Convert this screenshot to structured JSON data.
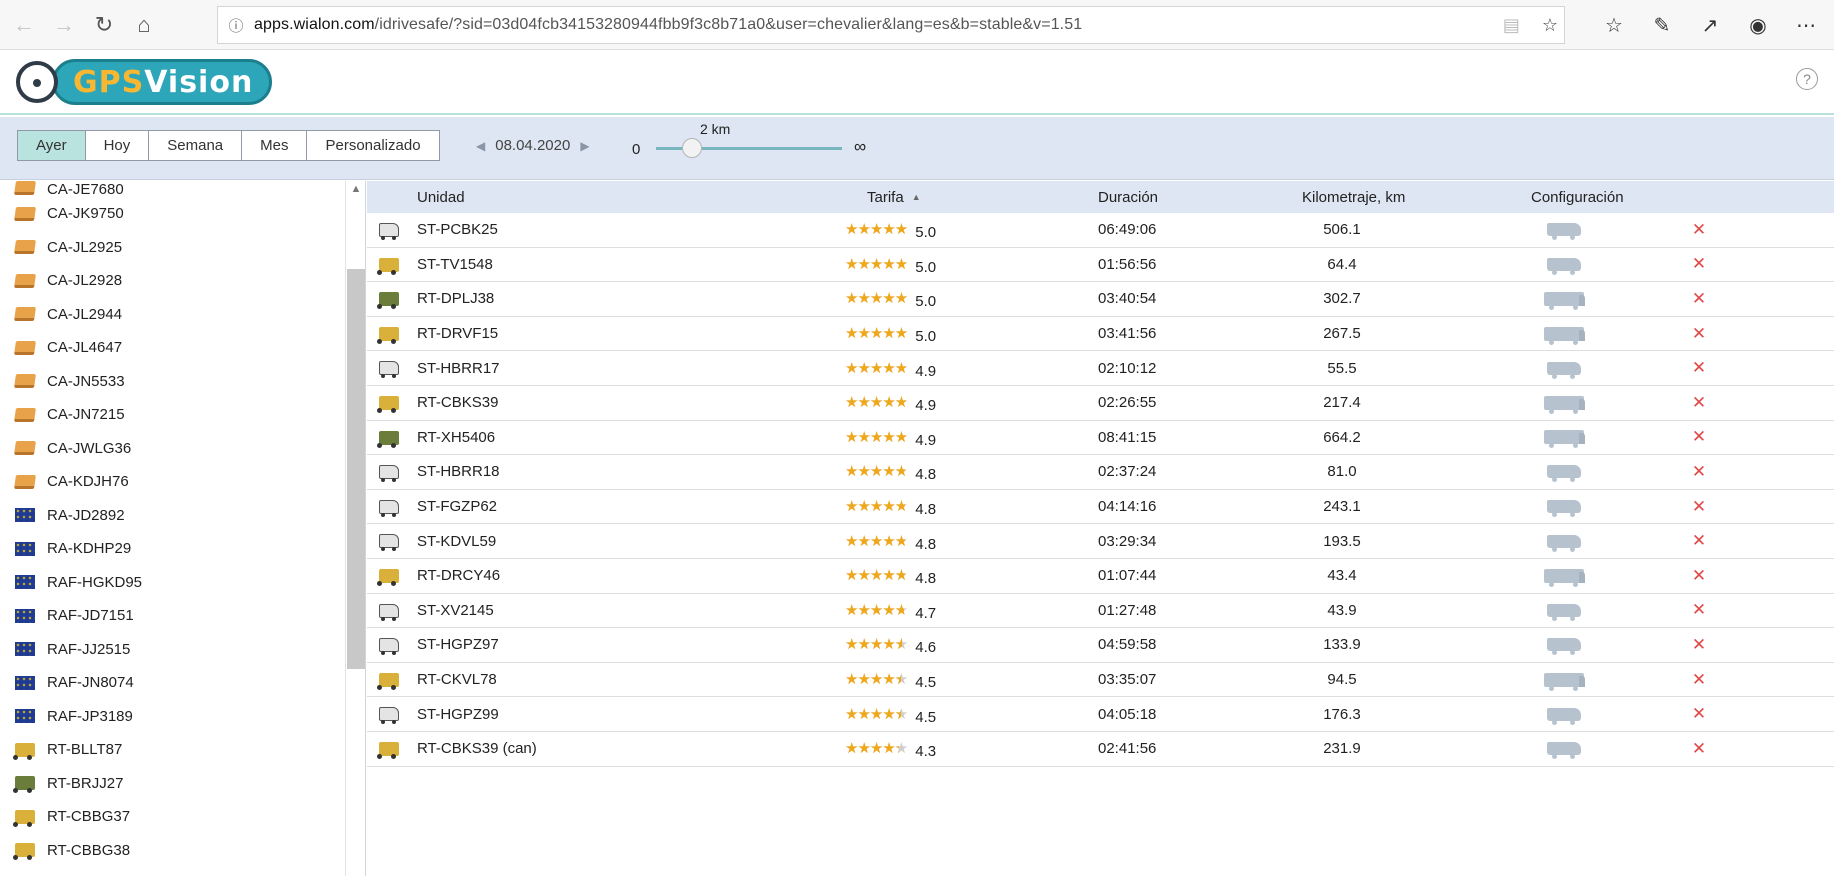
{
  "browser": {
    "url_prefix": "apps.wialon.com",
    "url_path": "/idrivesafe/?sid=03d04fcb34153280944fbb9f3c8b71a0&user=chevalier&lang=es&b=stable&v=1.51"
  },
  "app": {
    "logo_gps": "GPS",
    "logo_vision": "Vision",
    "help": "?"
  },
  "toolbar": {
    "periods": [
      "Ayer",
      "Hoy",
      "Semana",
      "Mes",
      "Personalizado"
    ],
    "active_period": "Ayer",
    "date": "08.04.2020",
    "slider_min": "0",
    "slider_value_label": "2 km",
    "slider_max": "∞"
  },
  "sidebar": {
    "items": [
      {
        "name": "CA-JE7680",
        "icon": "box-icon"
      },
      {
        "name": "CA-JK9750",
        "icon": "box-icon"
      },
      {
        "name": "CA-JL2925",
        "icon": "box-icon"
      },
      {
        "name": "CA-JL2928",
        "icon": "box-icon"
      },
      {
        "name": "CA-JL2944",
        "icon": "box-icon"
      },
      {
        "name": "CA-JL4647",
        "icon": "box-icon"
      },
      {
        "name": "CA-JN5533",
        "icon": "box-icon"
      },
      {
        "name": "CA-JN7215",
        "icon": "box-icon"
      },
      {
        "name": "CA-JWLG36",
        "icon": "box-icon"
      },
      {
        "name": "CA-KDJH76",
        "icon": "box-icon"
      },
      {
        "name": "RA-JD2892",
        "icon": "flag-icon"
      },
      {
        "name": "RA-KDHP29",
        "icon": "flag-icon"
      },
      {
        "name": "RAF-HGKD95",
        "icon": "flag-icon"
      },
      {
        "name": "RAF-JD7151",
        "icon": "flag-icon"
      },
      {
        "name": "RAF-JJ2515",
        "icon": "flag-icon"
      },
      {
        "name": "RAF-JN8074",
        "icon": "flag-icon"
      },
      {
        "name": "RAF-JP3189",
        "icon": "flag-icon"
      },
      {
        "name": "RT-BLLT87",
        "icon": "truck-icon"
      },
      {
        "name": "RT-BRJJ27",
        "icon": "green-truck-icon"
      },
      {
        "name": "RT-CBBG37",
        "icon": "truck-icon"
      },
      {
        "name": "RT-CBBG38",
        "icon": "truck-icon"
      }
    ]
  },
  "table": {
    "headers": {
      "unit": "Unidad",
      "tarifa": "Tarifa",
      "duration": "Duración",
      "km": "Kilometraje, km",
      "config": "Configuración"
    },
    "rows": [
      {
        "unit": "ST-PCBK25",
        "icon": "van-icon",
        "rating": 5.0,
        "score": "5.0",
        "duration": "06:49:06",
        "km": "506.1",
        "config": "van"
      },
      {
        "unit": "ST-TV1548",
        "icon": "truck-icon",
        "rating": 5.0,
        "score": "5.0",
        "duration": "01:56:56",
        "km": "64.4",
        "config": "van"
      },
      {
        "unit": "RT-DPLJ38",
        "icon": "green-truck-icon",
        "rating": 5.0,
        "score": "5.0",
        "duration": "03:40:54",
        "km": "302.7",
        "config": "truck"
      },
      {
        "unit": "RT-DRVF15",
        "icon": "truck-icon",
        "rating": 5.0,
        "score": "5.0",
        "duration": "03:41:56",
        "km": "267.5",
        "config": "truck"
      },
      {
        "unit": "ST-HBRR17",
        "icon": "van-icon",
        "rating": 4.9,
        "score": "4.9",
        "duration": "02:10:12",
        "km": "55.5",
        "config": "van"
      },
      {
        "unit": "RT-CBKS39",
        "icon": "truck-icon",
        "rating": 4.9,
        "score": "4.9",
        "duration": "02:26:55",
        "km": "217.4",
        "config": "truck"
      },
      {
        "unit": "RT-XH5406",
        "icon": "green-truck-icon",
        "rating": 4.9,
        "score": "4.9",
        "duration": "08:41:15",
        "km": "664.2",
        "config": "truck"
      },
      {
        "unit": "ST-HBRR18",
        "icon": "van-icon",
        "rating": 4.8,
        "score": "4.8",
        "duration": "02:37:24",
        "km": "81.0",
        "config": "van"
      },
      {
        "unit": "ST-FGZP62",
        "icon": "van-icon",
        "rating": 4.8,
        "score": "4.8",
        "duration": "04:14:16",
        "km": "243.1",
        "config": "van"
      },
      {
        "unit": "ST-KDVL59",
        "icon": "van-icon",
        "rating": 4.8,
        "score": "4.8",
        "duration": "03:29:34",
        "km": "193.5",
        "config": "van"
      },
      {
        "unit": "RT-DRCY46",
        "icon": "truck-icon",
        "rating": 4.8,
        "score": "4.8",
        "duration": "01:07:44",
        "km": "43.4",
        "config": "truck"
      },
      {
        "unit": "ST-XV2145",
        "icon": "van-icon",
        "rating": 4.7,
        "score": "4.7",
        "duration": "01:27:48",
        "km": "43.9",
        "config": "van"
      },
      {
        "unit": "ST-HGPZ97",
        "icon": "van-icon",
        "rating": 4.6,
        "score": "4.6",
        "duration": "04:59:58",
        "km": "133.9",
        "config": "van"
      },
      {
        "unit": "RT-CKVL78",
        "icon": "truck-icon",
        "rating": 4.5,
        "score": "4.5",
        "duration": "03:35:07",
        "km": "94.5",
        "config": "truck"
      },
      {
        "unit": "ST-HGPZ99",
        "icon": "van-icon",
        "rating": 4.5,
        "score": "4.5",
        "duration": "04:05:18",
        "km": "176.3",
        "config": "van"
      },
      {
        "unit": "RT-CBKS39 (can)",
        "icon": "truck-icon",
        "rating": 4.3,
        "score": "4.3",
        "duration": "02:41:56",
        "km": "231.9",
        "config": "van"
      }
    ],
    "delete_symbol": "✕"
  },
  "colors": {
    "accent": "#2ca6b8",
    "toolbar_bg": "#dde6f2",
    "active_period": "#b9e3de",
    "star": "#f0a81b",
    "delete": "#e04848"
  }
}
